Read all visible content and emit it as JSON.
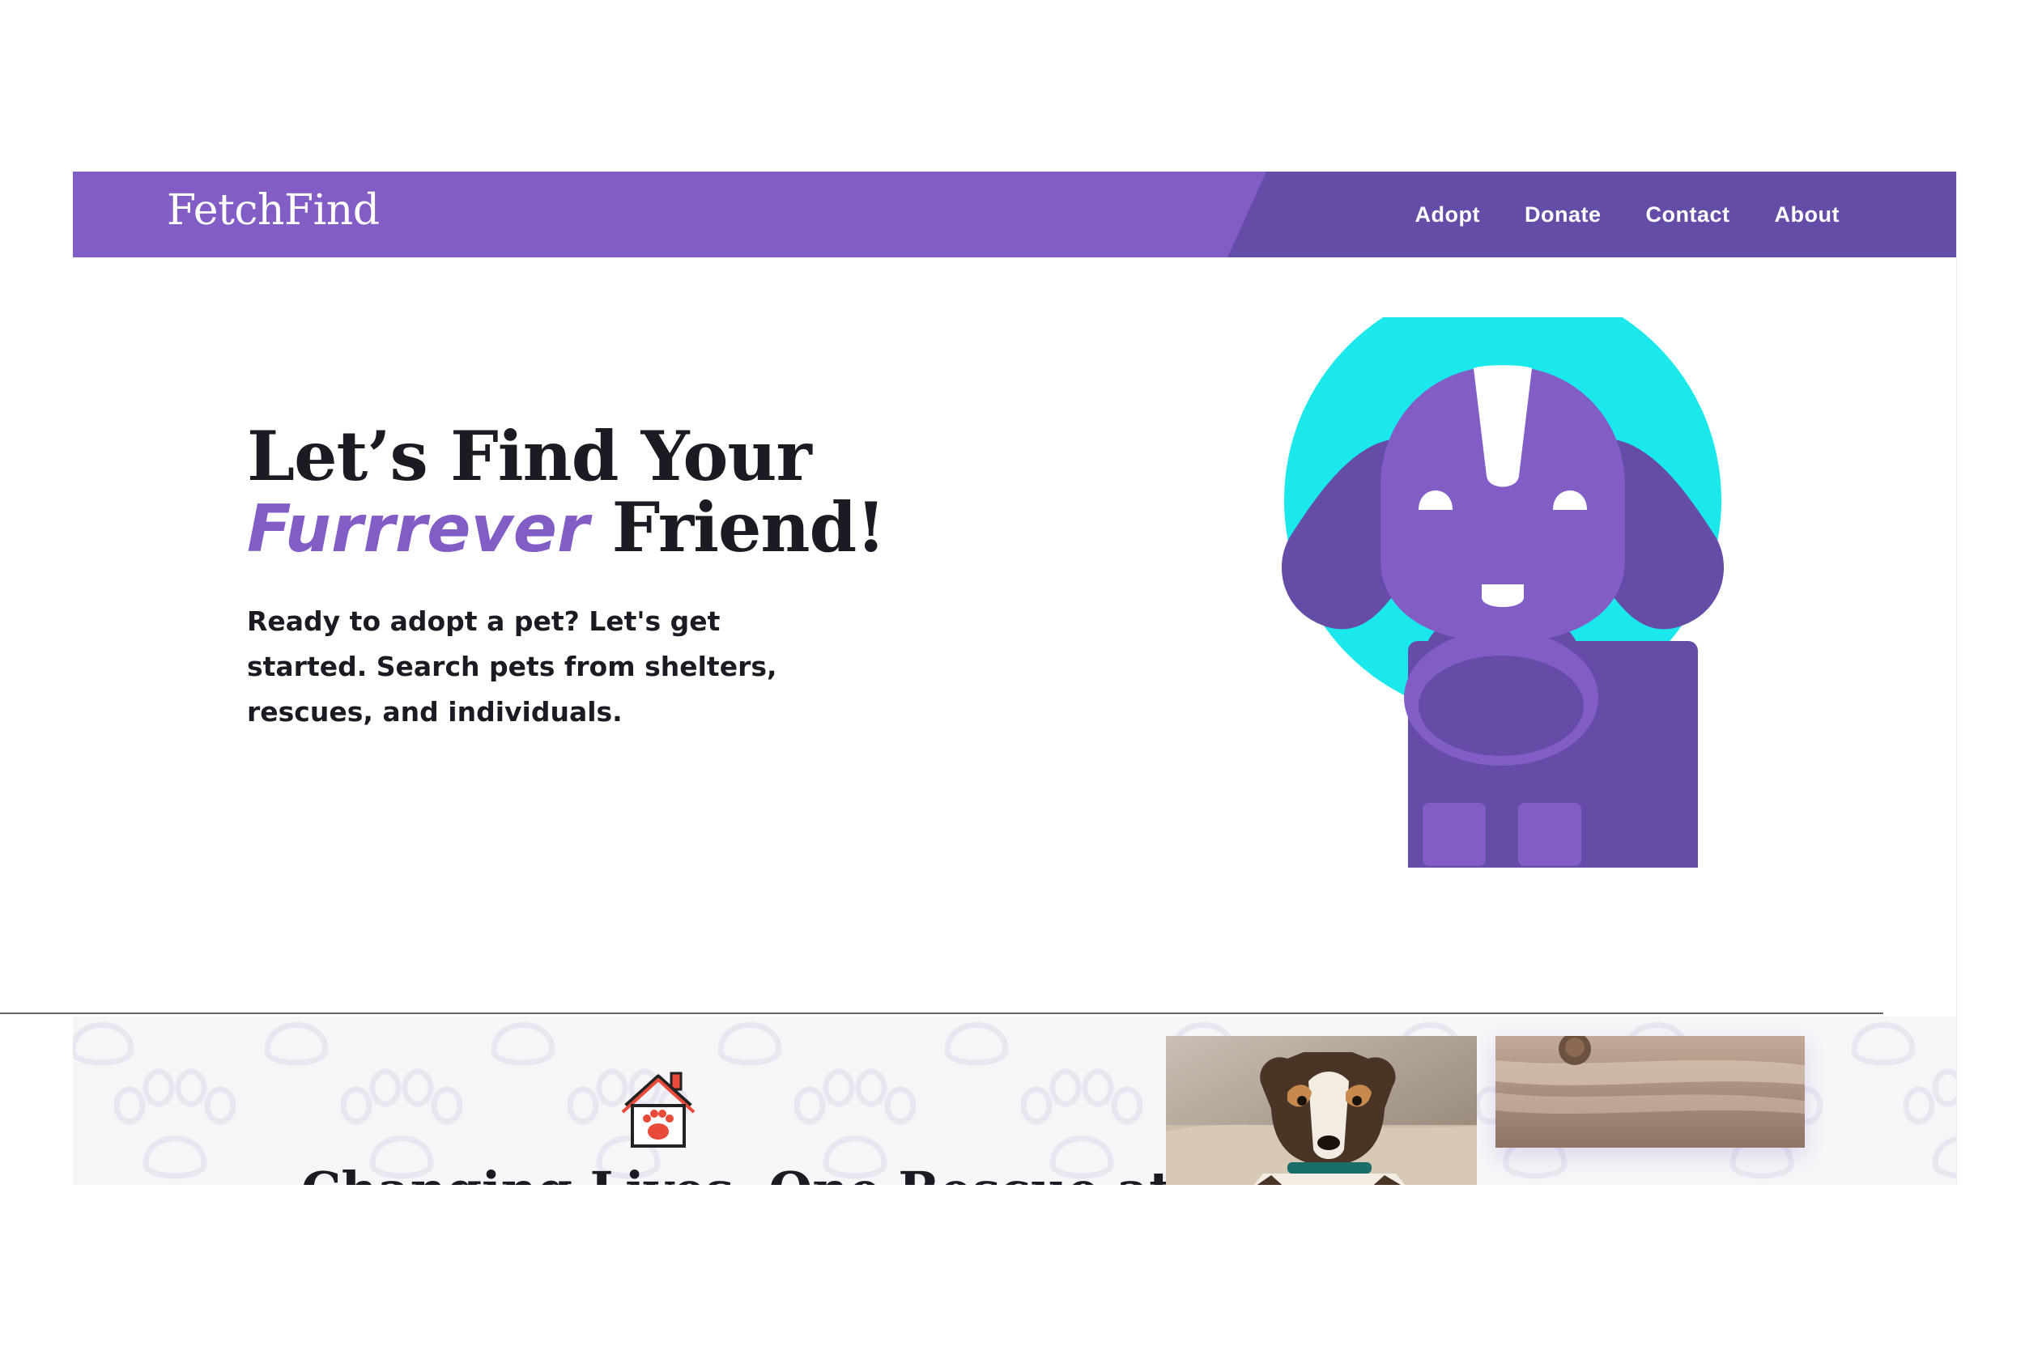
{
  "brand": {
    "name": "FetchFind"
  },
  "nav": {
    "items": [
      {
        "label": "Adopt"
      },
      {
        "label": "Donate"
      },
      {
        "label": "Contact"
      },
      {
        "label": "About"
      }
    ]
  },
  "hero": {
    "title_line1": "Let’s Find Your",
    "title_accent": "Furrrever",
    "title_end": " Friend!",
    "description": "Ready to adopt a pet? Let's get started. Search pets from shelters, rescues, and individuals."
  },
  "lower": {
    "heading": "Changing Lives, One Rescue at a Time"
  },
  "colors": {
    "brand_purple": "#835dc6",
    "dark_purple": "#654ca7",
    "teal": "#1be8ea",
    "text_dark": "#1e1a24"
  },
  "icons": [
    "house-paw-icon",
    "dog-illustration"
  ]
}
